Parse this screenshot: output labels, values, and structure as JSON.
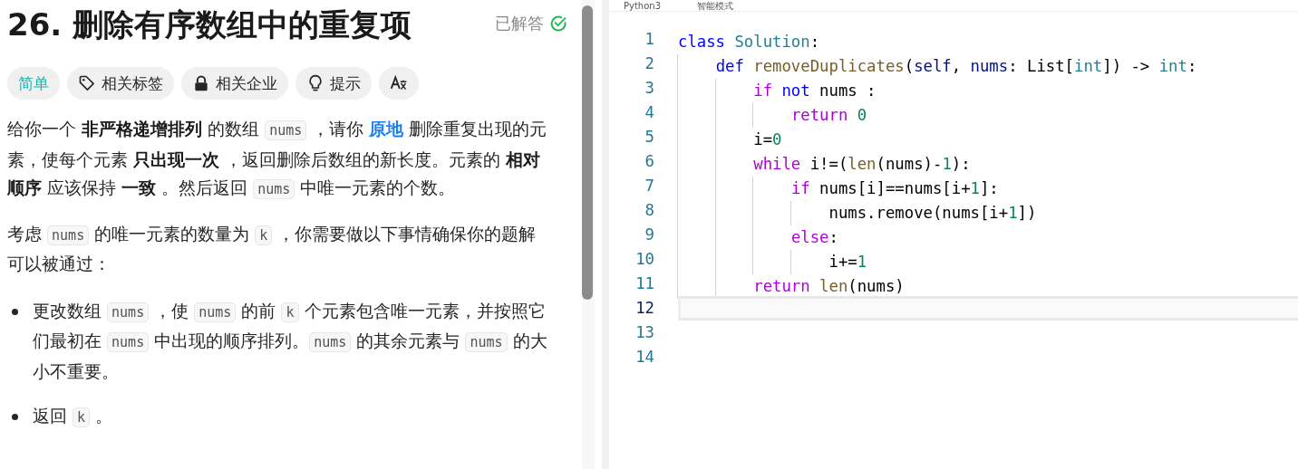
{
  "problem": {
    "title": "26. 删除有序数组中的重复项",
    "status": {
      "label": "已解答",
      "solved": true
    },
    "tags": [
      {
        "kind": "difficulty",
        "label": "简单"
      },
      {
        "kind": "tag",
        "label": "相关标签"
      },
      {
        "kind": "lock",
        "label": "相关企业"
      },
      {
        "kind": "hint",
        "label": "提示"
      },
      {
        "kind": "translate"
      }
    ],
    "paragraphs": [
      [
        {
          "kind": "text",
          "text": "给你一个 "
        },
        {
          "kind": "bold",
          "text": "非严格递增排列"
        },
        {
          "kind": "text",
          "text": " 的数组 "
        },
        {
          "kind": "code",
          "text": "nums"
        },
        {
          "kind": "text",
          "text": " ，请你 "
        },
        {
          "kind": "link",
          "text": "原地"
        },
        {
          "kind": "text",
          "text": " 删除重复出现的元素，使每个元素 "
        },
        {
          "kind": "bold",
          "text": "只出现一次"
        },
        {
          "kind": "text",
          "text": " ，返回删除后数组的新长度。元素的 "
        },
        {
          "kind": "bold",
          "text": "相对顺序"
        },
        {
          "kind": "text",
          "text": " 应该保持 "
        },
        {
          "kind": "bold",
          "text": "一致"
        },
        {
          "kind": "text",
          "text": " 。然后返回 "
        },
        {
          "kind": "code",
          "text": "nums"
        },
        {
          "kind": "text",
          "text": " 中唯一元素的个数。"
        }
      ],
      [
        {
          "kind": "text",
          "text": "考虑 "
        },
        {
          "kind": "code",
          "text": "nums"
        },
        {
          "kind": "text",
          "text": " 的唯一元素的数量为 "
        },
        {
          "kind": "code",
          "text": "k"
        },
        {
          "kind": "text",
          "text": " ，你需要做以下事情确保你的题解可以被通过："
        }
      ]
    ],
    "bullets": [
      [
        {
          "kind": "text",
          "text": "更改数组 "
        },
        {
          "kind": "code",
          "text": "nums"
        },
        {
          "kind": "text",
          "text": " ，使 "
        },
        {
          "kind": "code",
          "text": "nums"
        },
        {
          "kind": "text",
          "text": " 的前 "
        },
        {
          "kind": "code",
          "text": "k"
        },
        {
          "kind": "text",
          "text": " 个元素包含唯一元素，并按照它们最初在 "
        },
        {
          "kind": "code",
          "text": "nums"
        },
        {
          "kind": "text",
          "text": " 中出现的顺序排列。"
        },
        {
          "kind": "code",
          "text": "nums"
        },
        {
          "kind": "text",
          "text": " 的其余元素与 "
        },
        {
          "kind": "code",
          "text": "nums"
        },
        {
          "kind": "text",
          "text": " 的大小不重要。"
        }
      ],
      [
        {
          "kind": "text",
          "text": "返回 "
        },
        {
          "kind": "code",
          "text": "k"
        },
        {
          "kind": "text",
          "text": " 。"
        }
      ]
    ]
  },
  "editor": {
    "language": "Python3",
    "mode": "智能模式",
    "lines": [
      {
        "number": "1",
        "current": false,
        "tokens": [
          {
            "kind": "keyword",
            "text": "class"
          },
          {
            "kind": "type",
            "text": " Solution"
          },
          {
            "kind": "plain",
            "text": ":"
          }
        ]
      },
      {
        "number": "2",
        "current": false,
        "tokens": [
          {
            "kind": "keyword",
            "text": "    def"
          },
          {
            "kind": "function",
            "text": " removeDuplicates"
          },
          {
            "kind": "plain",
            "text": "("
          },
          {
            "kind": "variable",
            "text": "self"
          },
          {
            "kind": "plain",
            "text": ", "
          },
          {
            "kind": "variable",
            "text": "nums"
          },
          {
            "kind": "plain",
            "text": ": List["
          },
          {
            "kind": "type",
            "text": "int"
          },
          {
            "kind": "plain",
            "text": "]) -> "
          },
          {
            "kind": "type",
            "text": "int"
          },
          {
            "kind": "plain",
            "text": ":"
          }
        ]
      },
      {
        "number": "3",
        "current": false,
        "tokens": [
          {
            "kind": "control",
            "text": "        if"
          },
          {
            "kind": "keyword",
            "text": " not"
          },
          {
            "kind": "plain",
            "text": " nums :"
          }
        ]
      },
      {
        "number": "4",
        "current": false,
        "tokens": [
          {
            "kind": "control",
            "text": "            return"
          },
          {
            "kind": "number",
            "text": " 0"
          }
        ]
      },
      {
        "number": "5",
        "current": false,
        "tokens": [
          {
            "kind": "plain",
            "text": "        i="
          },
          {
            "kind": "number",
            "text": "0"
          }
        ]
      },
      {
        "number": "6",
        "current": false,
        "tokens": [
          {
            "kind": "control",
            "text": "        while"
          },
          {
            "kind": "plain",
            "text": " i!=("
          },
          {
            "kind": "function",
            "text": "len"
          },
          {
            "kind": "plain",
            "text": "(nums)-"
          },
          {
            "kind": "number",
            "text": "1"
          },
          {
            "kind": "plain",
            "text": "):"
          }
        ]
      },
      {
        "number": "7",
        "current": false,
        "tokens": [
          {
            "kind": "control",
            "text": "            if"
          },
          {
            "kind": "plain",
            "text": " nums[i]==nums[i+"
          },
          {
            "kind": "number",
            "text": "1"
          },
          {
            "kind": "plain",
            "text": "]:"
          }
        ]
      },
      {
        "number": "8",
        "current": false,
        "tokens": [
          {
            "kind": "plain",
            "text": "                nums.remove(nums[i+"
          },
          {
            "kind": "number",
            "text": "1"
          },
          {
            "kind": "plain",
            "text": "])"
          }
        ]
      },
      {
        "number": "9",
        "current": false,
        "tokens": [
          {
            "kind": "control",
            "text": "            else"
          },
          {
            "kind": "plain",
            "text": ":"
          }
        ]
      },
      {
        "number": "10",
        "current": false,
        "tokens": [
          {
            "kind": "plain",
            "text": "                i+="
          },
          {
            "kind": "number",
            "text": "1"
          }
        ]
      },
      {
        "number": "11",
        "current": false,
        "tokens": [
          {
            "kind": "control",
            "text": "        return"
          },
          {
            "kind": "function",
            "text": " len"
          },
          {
            "kind": "plain",
            "text": "(nums)"
          }
        ]
      },
      {
        "number": "12",
        "current": true
      },
      {
        "number": "13",
        "current": false
      },
      {
        "number": "14",
        "current": false
      }
    ]
  }
}
